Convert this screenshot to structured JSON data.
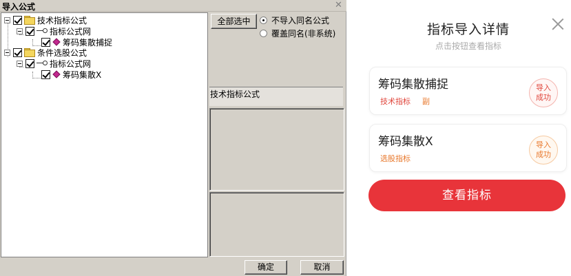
{
  "dialog": {
    "title": "导入公式",
    "close_glyph": "✕",
    "tree": [
      {
        "label": "技术指标公式",
        "icon": "folder-icon"
      },
      {
        "label": "指标公式网",
        "icon": "key-icon"
      },
      {
        "label": "筹码集散捕捉",
        "icon": "gem-icon"
      },
      {
        "label": "条件选股公式",
        "icon": "folder-icon"
      },
      {
        "label": "指标公式网",
        "icon": "key-icon"
      },
      {
        "label": "筹码集散X",
        "icon": "gem-icon"
      }
    ],
    "select_all_label": "全部选中",
    "radio_options": [
      {
        "label": "不导入同名公式",
        "selected": true
      },
      {
        "label": "覆盖同名(非系统)",
        "selected": false
      }
    ],
    "info_label": "技术指标公式",
    "ok_label": "确定",
    "cancel_label": "取消"
  },
  "modal": {
    "title": "指标导入详情",
    "subtitle": "点击按钮查看指标",
    "items": [
      {
        "name": "筹码集散捕捉",
        "tags": [
          "技术指标",
          "副"
        ],
        "status": [
          "导入",
          "成功"
        ],
        "accent": "#e0463c"
      },
      {
        "name": "筹码集散X",
        "tags": [
          "选股指标"
        ],
        "status": [
          "导入",
          "成功"
        ],
        "accent": "#e8782c"
      }
    ],
    "view_button_label": "查看指标",
    "colors": {
      "primary": "#e8343a",
      "tag_red": "#e0463c",
      "tag_orange": "#e8782c"
    }
  }
}
